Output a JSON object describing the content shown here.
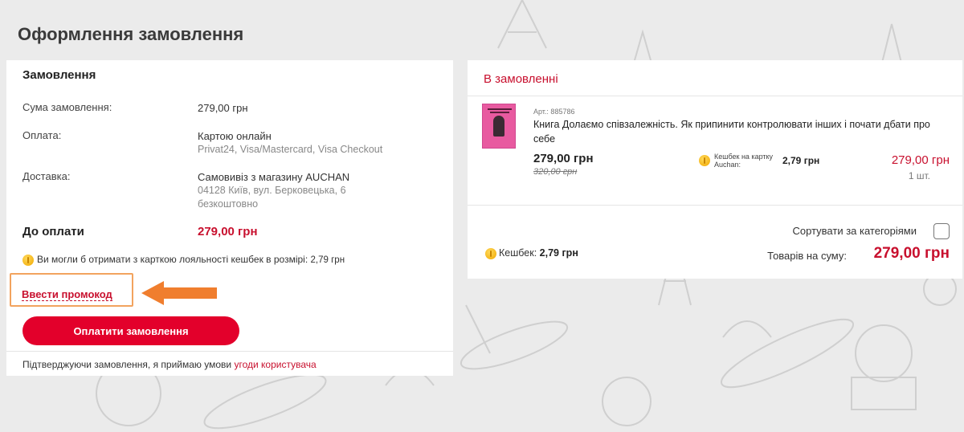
{
  "page": {
    "title": "Оформлення замовлення"
  },
  "order_summary": {
    "title": "Замовлення",
    "sum_label": "Сума замовлення:",
    "sum_value": "279,00 грн",
    "payment_label": "Оплата:",
    "payment_value": "Картою онлайн",
    "payment_sub": "Privat24, Visa/Mastercard, Visa Checkout",
    "delivery_label": "Доставка:",
    "delivery_value": "Самовивіз з магазину AUCHAN",
    "delivery_address": "04128 Київ, вул. Берковецька, 6",
    "delivery_cost": "безкоштовно",
    "to_pay_label": "До оплати",
    "to_pay_value": "279,00 грн",
    "cashback_note": "Ви могли б отримати з карткою лояльності кешбек в розмірі:",
    "cashback_note_value": "2,79 грн"
  },
  "promo": {
    "link_label": "Ввести промокод"
  },
  "pay_button": {
    "label": "Оплатити замовлення"
  },
  "consent": {
    "text": "Підтверджуючи замовлення, я приймаю умови",
    "link": "угоди користувача"
  },
  "cart": {
    "title": "В замовленні",
    "item": {
      "art": "Арт.: 885786",
      "name": "Книга Долаємо співзалежність. Як припинити контролювати інших і почати дбати про себе",
      "price": "279,00 грн",
      "old_price": "320,00 грн",
      "cashback_label": "Кешбек на картку Auchan:",
      "cashback_value": "2,79 грн",
      "total": "279,00 грн",
      "qty": "1 шт."
    },
    "sort_label": "Сортувати за категоріями",
    "sort_checked": false,
    "cashback_total_label": "Кешбек:",
    "cashback_total_value": "2,79 грн",
    "sum_label": "Товарів на суму:",
    "sum_value": "279,00 грн"
  },
  "colors": {
    "accent": "#c8102e",
    "button": "#e3002b",
    "highlight_arrow": "#f07e2e",
    "background": "#ebebeb"
  }
}
